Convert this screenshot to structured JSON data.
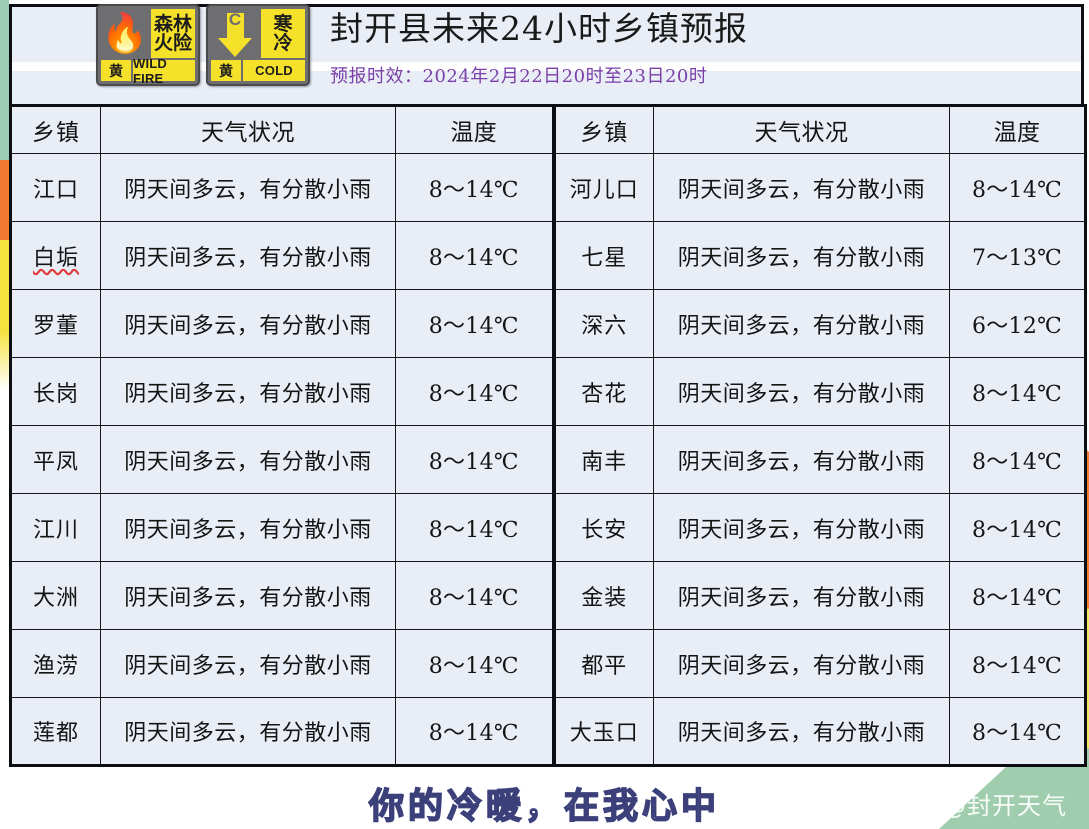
{
  "header": {
    "title": "封开县未来24小时乡镇预报",
    "subtitle": "预报时效：2024年2月22日20时至23日20时",
    "badges": [
      {
        "icon": "flame-icon",
        "word_top": "森林",
        "word_bottom": "火险",
        "level": "黄",
        "english": "WILD FIRE"
      },
      {
        "icon": "cold-arrow-icon",
        "arrow_letter": "C",
        "word_top": "寒",
        "word_bottom": "冷",
        "level": "黄",
        "english": "COLD"
      }
    ]
  },
  "table": {
    "headers_left": [
      "乡镇",
      "天气状况",
      "温度"
    ],
    "headers_right": [
      "乡镇",
      "天气状况",
      "温度"
    ],
    "rows": [
      {
        "left_town": "江口",
        "left_cond": "阴天间多云，有分散小雨",
        "left_temp": "8～14℃",
        "right_town": "河儿口",
        "right_cond": "阴天间多云，有分散小雨",
        "right_temp": "8～14℃"
      },
      {
        "left_town": "白垢",
        "left_cond": "阴天间多云，有分散小雨",
        "left_temp": "8～14℃",
        "right_town": "七星",
        "right_cond": "阴天间多云，有分散小雨",
        "right_temp": "7～13℃"
      },
      {
        "left_town": "罗董",
        "left_cond": "阴天间多云，有分散小雨",
        "left_temp": "8～14℃",
        "right_town": "深六",
        "right_cond": "阴天间多云，有分散小雨",
        "right_temp": "6～12℃"
      },
      {
        "left_town": "长岗",
        "left_cond": "阴天间多云，有分散小雨",
        "left_temp": "8～14℃",
        "right_town": "杏花",
        "right_cond": "阴天间多云，有分散小雨",
        "right_temp": "8～14℃"
      },
      {
        "left_town": "平凤",
        "left_cond": "阴天间多云，有分散小雨",
        "left_temp": "8～14℃",
        "right_town": "南丰",
        "right_cond": "阴天间多云，有分散小雨",
        "right_temp": "8～14℃"
      },
      {
        "left_town": "江川",
        "left_cond": "阴天间多云，有分散小雨",
        "left_temp": "8～14℃",
        "right_town": "长安",
        "right_cond": "阴天间多云，有分散小雨",
        "right_temp": "8～14℃"
      },
      {
        "left_town": "大洲",
        "left_cond": "阴天间多云，有分散小雨",
        "left_temp": "8～14℃",
        "right_town": "金装",
        "right_cond": "阴天间多云，有分散小雨",
        "right_temp": "8～14℃"
      },
      {
        "left_town": "渔涝",
        "left_cond": "阴天间多云，有分散小雨",
        "left_temp": "8～14℃",
        "right_town": "都平",
        "right_cond": "阴天间多云，有分散小雨",
        "right_temp": "8～14℃"
      },
      {
        "left_town": "莲都",
        "left_cond": "阴天间多云，有分散小雨",
        "left_temp": "8～14℃",
        "right_town": "大玉口",
        "right_cond": "阴天间多云，有分散小雨",
        "right_temp": "8～14℃"
      }
    ]
  },
  "footer": {
    "slogan": "你的冷暖，在我心中",
    "watermark_handle": "@封开天气",
    "watermark_icon": "weibo-icon"
  },
  "colors": {
    "cell_background": "#e9eef6",
    "border": "#0d0d14",
    "subtitle_purple": "#7a3fa8",
    "warning_yellow": "#f5e02a",
    "warning_gray": "#6e6e70",
    "ribbon_green": "#9bcdb4",
    "ribbon_orange": "#f07a32",
    "ribbon_yellow": "#f5e23c",
    "slogan_outline": "#3b3f7a"
  }
}
